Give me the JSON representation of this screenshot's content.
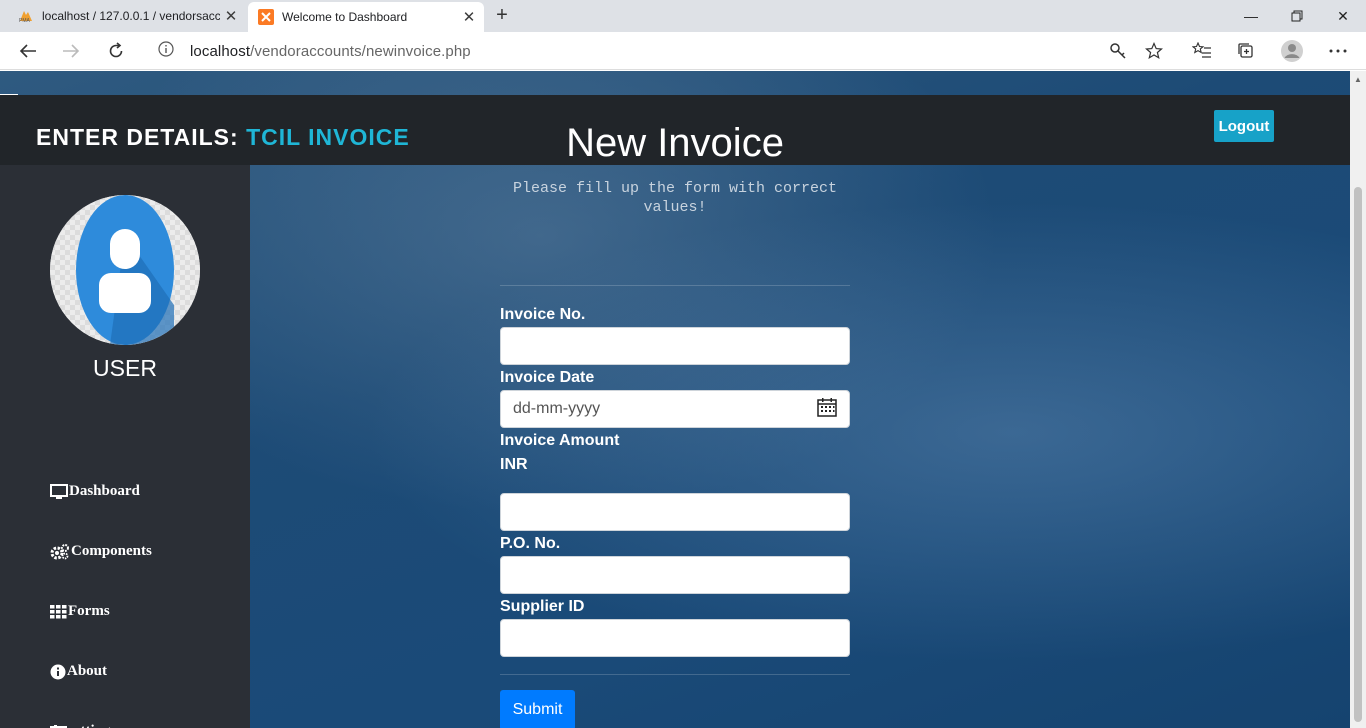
{
  "browser": {
    "tabs": [
      {
        "title": "localhost / 127.0.0.1 / vendorsacc",
        "active": false,
        "icon": "phpmyadmin-icon"
      },
      {
        "title": "Welcome to Dashboard",
        "active": true,
        "icon": "xampp-icon"
      }
    ],
    "url_host": "localhost",
    "url_path": "/vendoraccounts/newinvoice.php"
  },
  "header": {
    "brand_prefix": "ENTER DETAILS:",
    "brand_accent": "TCIL INVOICE",
    "logout_label": "Logout"
  },
  "sidebar": {
    "username": "USER",
    "items": [
      {
        "label": "Dashboard",
        "icon": "monitor-icon"
      },
      {
        "label": "Components",
        "icon": "gears-icon"
      },
      {
        "label": "Forms",
        "icon": "grid-icon"
      },
      {
        "label": "About",
        "icon": "info-icon"
      },
      {
        "label": "settings",
        "icon": "sliders-icon"
      }
    ]
  },
  "form": {
    "title": "New Invoice",
    "subtitle": "Please fill up the form with correct values!",
    "invoice_no_label": "Invoice No.",
    "invoice_date_label": "Invoice Date",
    "invoice_date_placeholder": "dd-mm-yyyy",
    "invoice_amount_label": "Invoice Amount",
    "currency_label": "INR",
    "po_no_label": "P.O. No.",
    "supplier_id_label": "Supplier ID",
    "submit_label": "Submit"
  },
  "colors": {
    "accent": "#1fb6d6",
    "topbar": "#212529",
    "sidebar": "#2b2f36",
    "submit": "#007bff"
  }
}
